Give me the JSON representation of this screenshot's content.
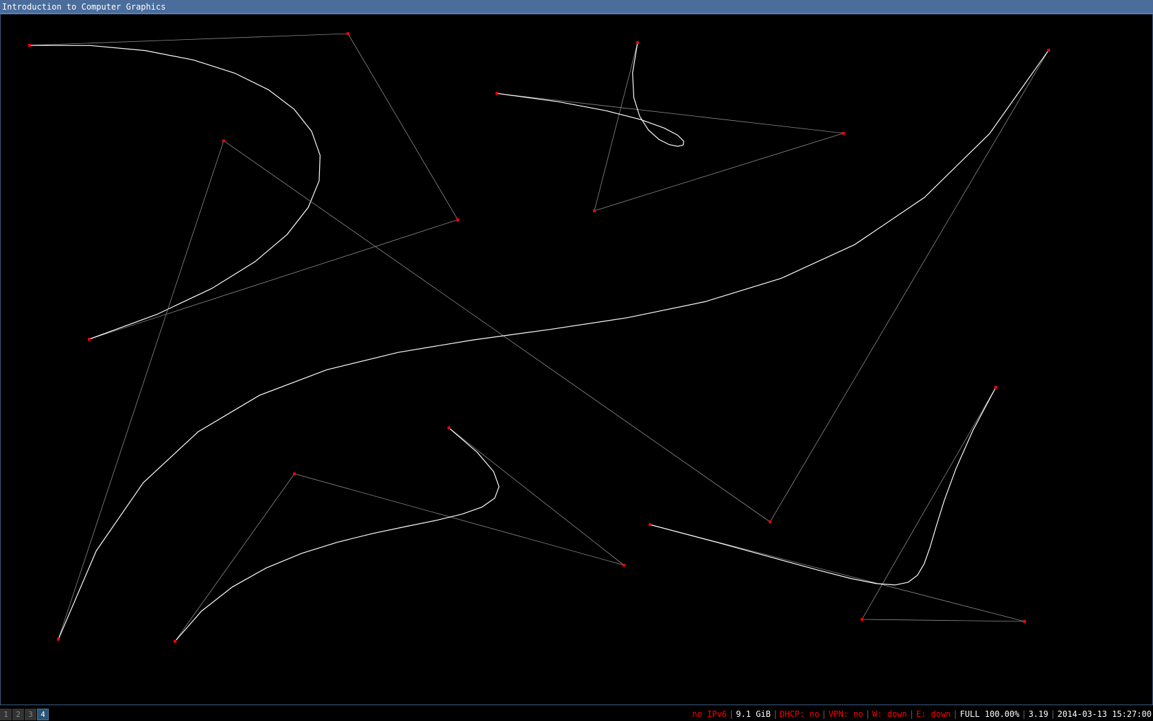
{
  "window": {
    "title": "Introduction to Computer Graphics"
  },
  "colors": {
    "background": "#000000",
    "control_polygon": "#8c8c8c",
    "curve": "#ffffff",
    "control_point": "#ff0000",
    "titlebar": "#4a6d9c",
    "status_bad": "#ff0000",
    "status_ok": "#ffffff"
  },
  "workspaces": [
    {
      "label": "1",
      "active": false
    },
    {
      "label": "2",
      "active": false
    },
    {
      "label": "3",
      "active": false
    },
    {
      "label": "4",
      "active": true
    }
  ],
  "status": {
    "ipv6": "no IPv6",
    "disk": "9.1 GiB",
    "dhcp": "DHCP: no",
    "vpn": "VPN: no",
    "wireless": "W: down",
    "ethernet": "E: down",
    "battery": "FULL 100.00%",
    "load": "3.19",
    "datetime": "2014-03-13 15:27:00"
  }
}
